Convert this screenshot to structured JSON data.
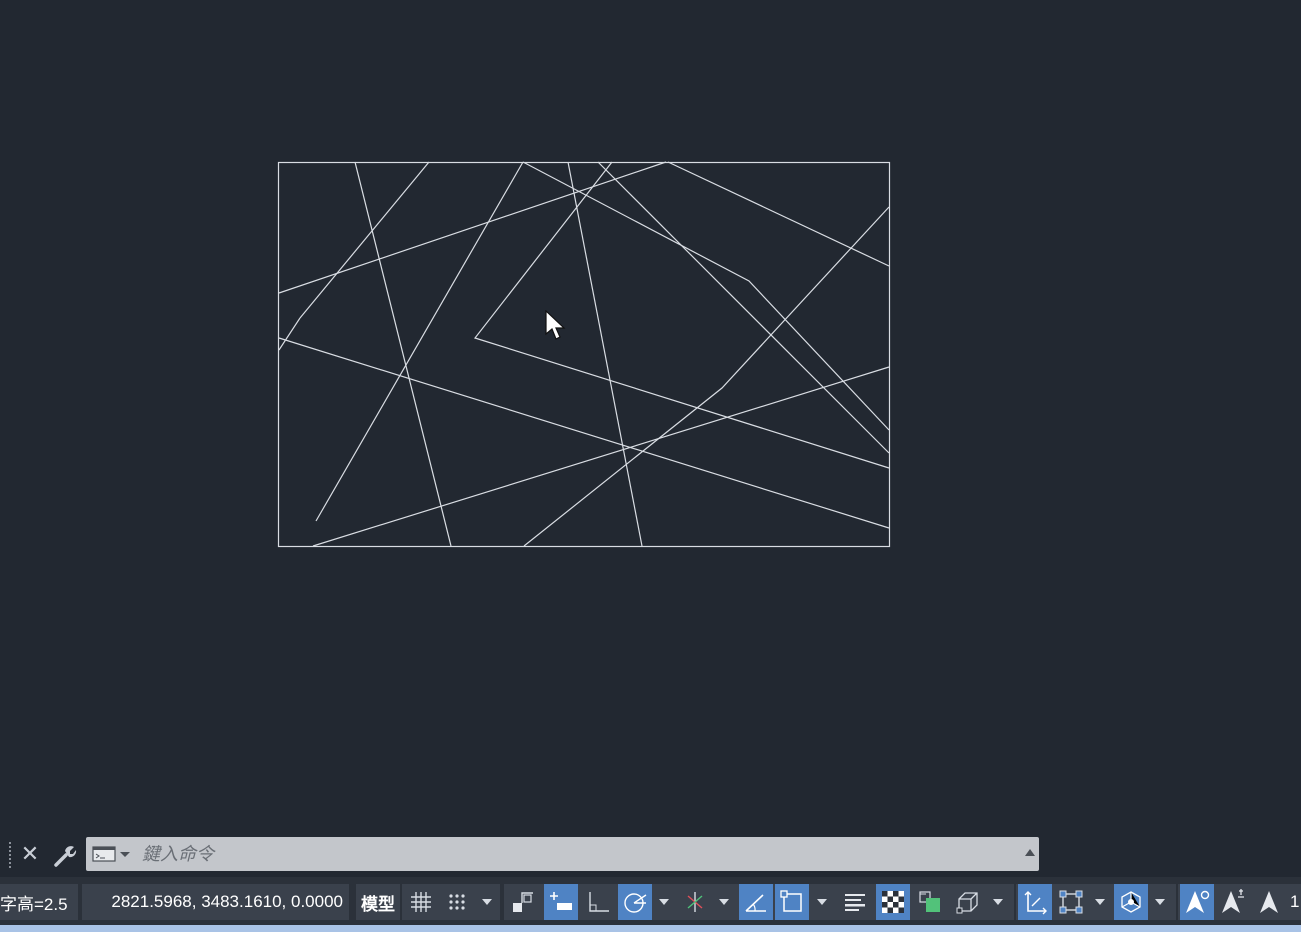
{
  "command_line": {
    "placeholder": "鍵入命令",
    "close_icon": "close-icon",
    "settings_icon": "wrench-icon",
    "recent_icon": "command-history-icon"
  },
  "status_bar": {
    "text_height": "字高=2.5",
    "coordinates": "2821.5968, 3483.1610, 0.0000",
    "model_label": "模型",
    "trailing_text": "1",
    "toggles": [
      {
        "name": "grid",
        "icon": "grid-icon",
        "active": false
      },
      {
        "name": "snap",
        "icon": "snap-dots-icon",
        "active": false
      },
      {
        "name": "infer-constraints",
        "icon": "infer-constraints-icon",
        "active": false
      },
      {
        "name": "dynamic-input",
        "icon": "dynamic-input-icon",
        "active": true
      },
      {
        "name": "ortho",
        "icon": "ortho-icon",
        "active": false
      },
      {
        "name": "polar",
        "icon": "polar-tracking-icon",
        "active": true
      },
      {
        "name": "isometric",
        "icon": "isodraft-icon",
        "active": false
      },
      {
        "name": "object-snap-tracking",
        "icon": "osnap-tracking-icon",
        "active": true
      },
      {
        "name": "object-snap",
        "icon": "object-snap-icon",
        "active": true
      },
      {
        "name": "lineweight",
        "icon": "lineweight-icon",
        "active": false
      },
      {
        "name": "transparency",
        "icon": "transparency-icon",
        "active": true
      },
      {
        "name": "selection-cycling",
        "icon": "selection-cycling-icon",
        "active": false
      },
      {
        "name": "3d-osnap",
        "icon": "3d-object-snap-icon",
        "active": false
      },
      {
        "name": "dynamic-ucs",
        "icon": "dynamic-ucs-icon",
        "active": true
      },
      {
        "name": "selection-filter",
        "icon": "selection-filter-icon",
        "active": false
      },
      {
        "name": "gizmo",
        "icon": "gizmo-icon",
        "active": true
      },
      {
        "name": "annotation-visibility",
        "icon": "annotation-visibility-icon",
        "active": true
      },
      {
        "name": "auto-scale",
        "icon": "auto-scale-icon",
        "active": false
      },
      {
        "name": "annotation-scale",
        "icon": "annotation-scale-icon",
        "active": false
      }
    ]
  },
  "colors": {
    "background": "#222831",
    "line": "#d9dde3",
    "active_toggle": "#4f83c4"
  }
}
